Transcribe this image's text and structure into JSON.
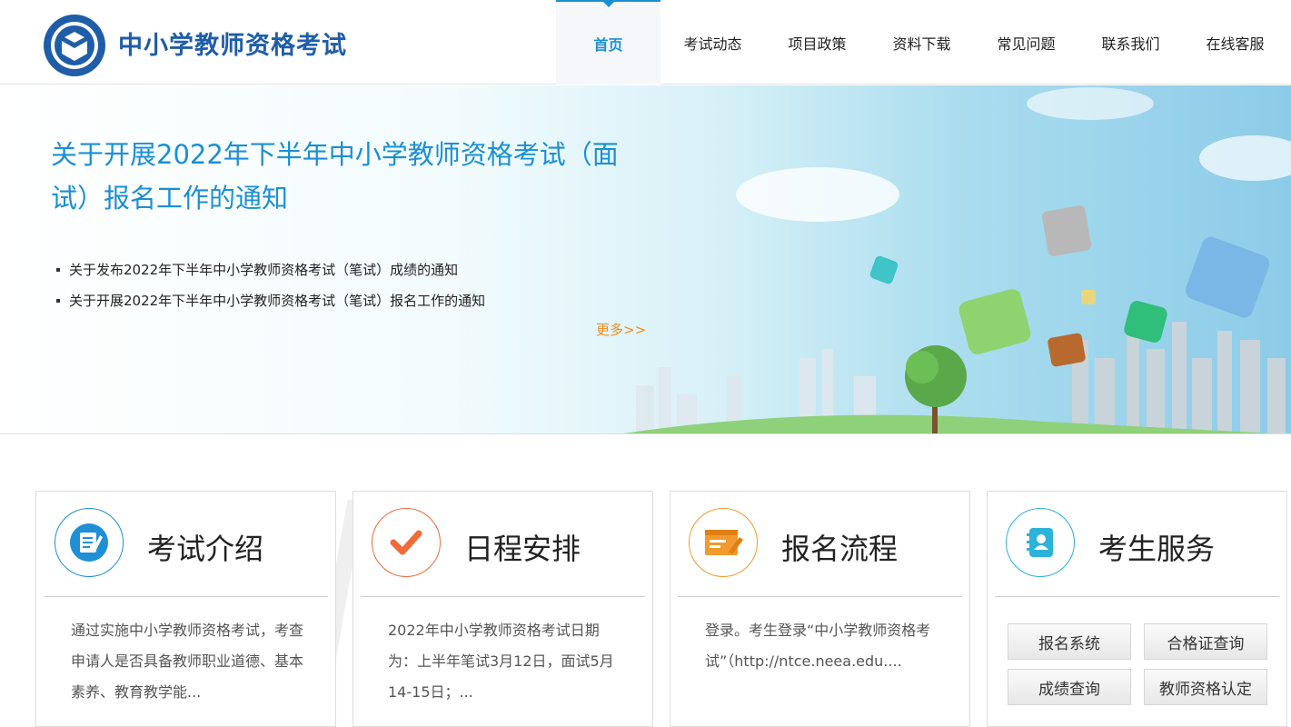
{
  "site": {
    "title": "中小学教师资格考试"
  },
  "nav": {
    "items": [
      {
        "label": "首页",
        "active": true
      },
      {
        "label": "考试动态"
      },
      {
        "label": "项目政策"
      },
      {
        "label": "资料下载"
      },
      {
        "label": "常见问题"
      },
      {
        "label": "联系我们"
      },
      {
        "label": "在线客服"
      }
    ]
  },
  "banner": {
    "headline": "关于开展2022年下半年中小学教师资格考试（面试）报名工作的通知",
    "news": [
      "关于发布2022年下半年中小学教师资格考试（笔试）成绩的通知",
      "关于开展2022年下半年中小学教师资格考试（笔试）报名工作的通知"
    ],
    "more": "更多>>"
  },
  "cards": [
    {
      "title": "考试介绍",
      "icon": "document-edit-icon",
      "color": "#1f8fd6",
      "text": "通过实施中小学教师资格考试，考查申请人是否具备教师职业道德、基本素养、教育教学能..."
    },
    {
      "title": "日程安排",
      "icon": "checkmark-icon",
      "color": "#f06a3a",
      "text": "2022年中小学教师资格考试日期为：上半年笔试3月12日，面试5月14-15日；..."
    },
    {
      "title": "报名流程",
      "icon": "registration-form-icon",
      "color": "#f29a2e",
      "text": "登录。考生登录“中小学教师资格考试”（http://ntce.neea.edu...."
    },
    {
      "title": "考生服务",
      "icon": "contact-book-icon",
      "color": "#2bb3d9",
      "buttons": [
        "报名系统",
        "合格证查询",
        "成绩查询",
        "教师资格认定"
      ]
    }
  ],
  "colors": {
    "brand": "#1f5da8",
    "accent": "#1a8fd6",
    "more": "#f08a1c"
  }
}
